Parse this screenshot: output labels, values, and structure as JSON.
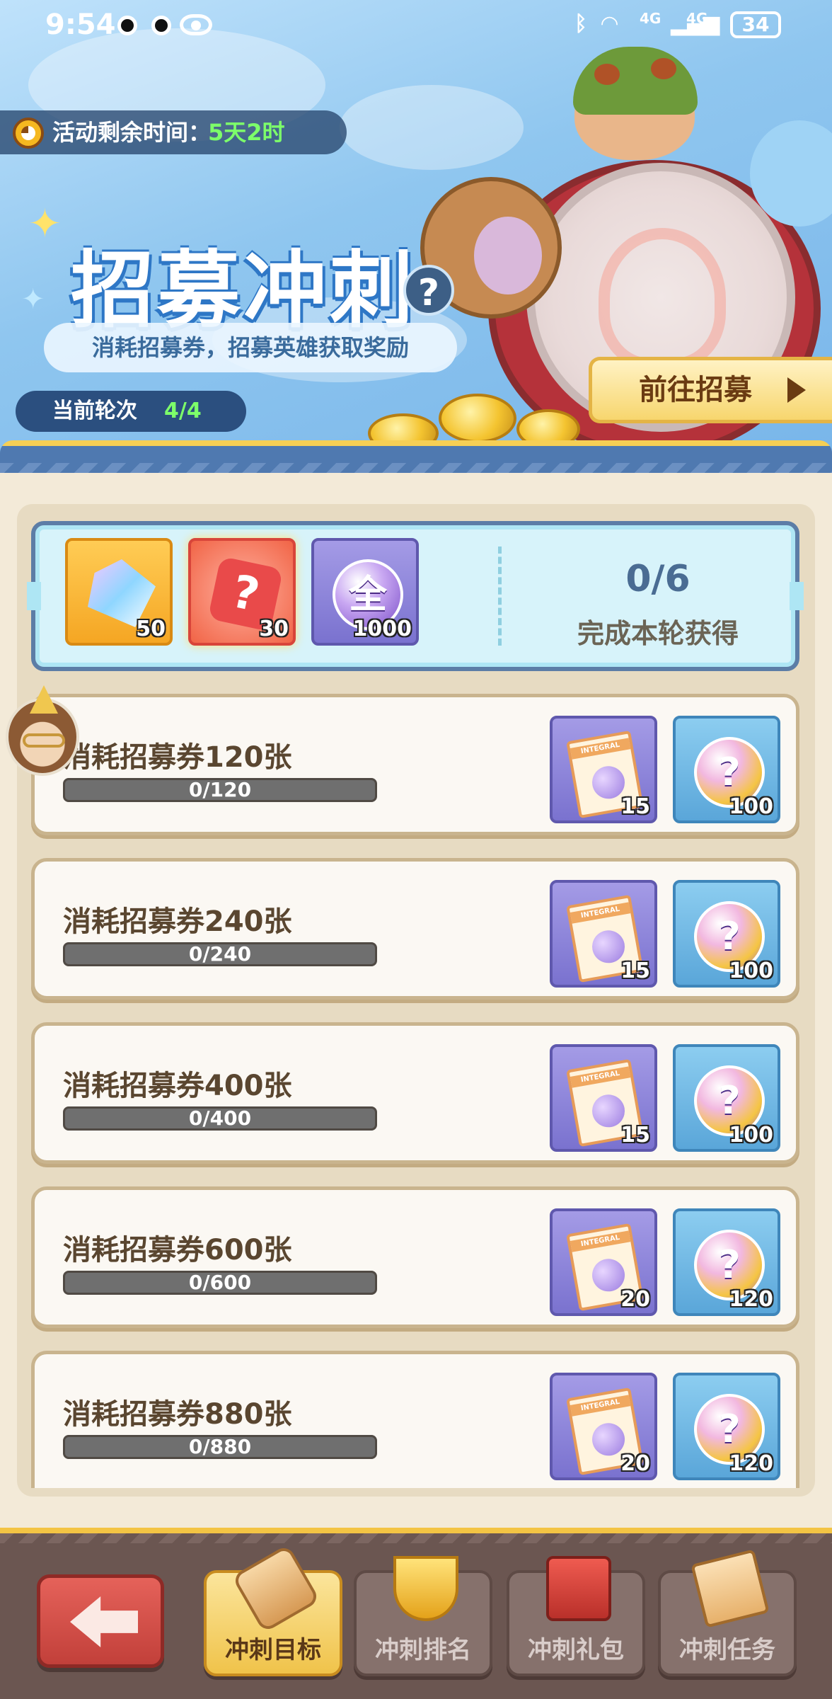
{
  "status_bar": {
    "time": "9:54",
    "network_1": "4G",
    "network_2": "4G",
    "battery": "34"
  },
  "banner": {
    "timer_label": "活动剩余时间：",
    "timer_value": "5天2时",
    "title": "招募冲刺",
    "subtitle": "消耗招募券，招募英雄获取奖励",
    "round_label": "当前轮次",
    "round_value": "4/4",
    "goto_button": "前往招募"
  },
  "summary": {
    "rewards": [
      {
        "icon": "crystal-icon",
        "qty": "50"
      },
      {
        "icon": "mystery-puzzle-icon",
        "qty": "30"
      },
      {
        "icon": "all-orb-icon",
        "label": "全",
        "qty": "1000"
      }
    ],
    "progress": "0/6",
    "caption": "完成本轮获得"
  },
  "tasks": [
    {
      "name": "消耗招募券120张",
      "progress": "0/120",
      "ticket_qty": "15",
      "orb_qty": "100",
      "ticket_text": "INTEGRAL",
      "orb_label": "?"
    },
    {
      "name": "消耗招募券240张",
      "progress": "0/240",
      "ticket_qty": "15",
      "orb_qty": "100",
      "ticket_text": "INTEGRAL",
      "orb_label": "?"
    },
    {
      "name": "消耗招募券400张",
      "progress": "0/400",
      "ticket_qty": "15",
      "orb_qty": "100",
      "ticket_text": "INTEGRAL",
      "orb_label": "?"
    },
    {
      "name": "消耗招募券600张",
      "progress": "0/600",
      "ticket_qty": "20",
      "orb_qty": "120",
      "ticket_text": "INTEGRAL",
      "orb_label": "?"
    },
    {
      "name": "消耗招募券880张",
      "progress": "0/880",
      "ticket_qty": "20",
      "orb_qty": "120",
      "ticket_text": "INTEGRAL",
      "orb_label": "?"
    }
  ],
  "nav": {
    "tabs": [
      {
        "label": "冲刺目标",
        "active": true,
        "icon": "scroll-icon"
      },
      {
        "label": "冲刺排名",
        "active": false,
        "icon": "trophy-icon"
      },
      {
        "label": "冲刺礼包",
        "active": false,
        "icon": "gift-icon"
      },
      {
        "label": "冲刺任务",
        "active": false,
        "icon": "quest-scroll-icon"
      }
    ]
  },
  "colors": {
    "highlight_green": "#7dff6a",
    "panel_bg": "#f3ead8",
    "nav_bg": "#6b5651",
    "accent_gold": "#f3c444"
  }
}
